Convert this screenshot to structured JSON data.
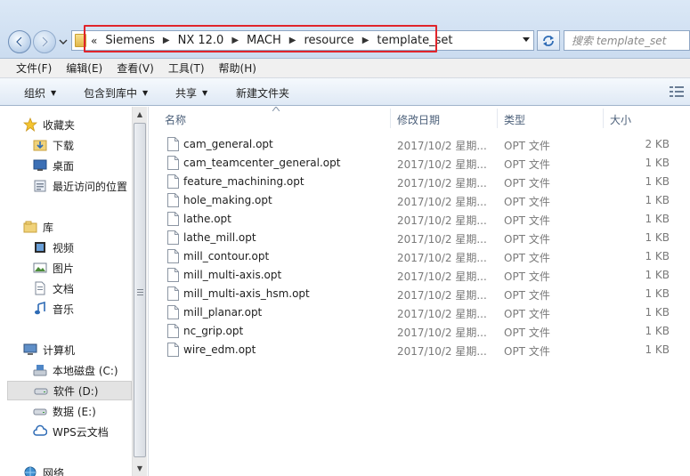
{
  "address_bar": {
    "overflow_glyph": "«",
    "crumbs": [
      "Siemens",
      "NX 12.0",
      "MACH",
      "resource",
      "template_set"
    ],
    "search_placeholder": "搜索 template_set"
  },
  "menu": [
    "文件(F)",
    "编辑(E)",
    "查看(V)",
    "工具(T)",
    "帮助(H)"
  ],
  "toolbar": {
    "organize": "组织",
    "include_in_library": "包含到库中",
    "share": "共享",
    "new_folder": "新建文件夹"
  },
  "sidebar": {
    "favorites": {
      "label": "收藏夹",
      "items": [
        "下载",
        "桌面",
        "最近访问的位置"
      ]
    },
    "libraries": {
      "label": "库",
      "items": [
        "视频",
        "图片",
        "文档",
        "音乐"
      ]
    },
    "computer": {
      "label": "计算机",
      "items": [
        "本地磁盘 (C:)",
        "软件 (D:)",
        "数据 (E:)",
        "WPS云文档"
      ]
    },
    "network": {
      "label": "网络"
    },
    "selected": "软件 (D:)"
  },
  "columns": {
    "name": "名称",
    "date": "修改日期",
    "type": "类型",
    "size": "大小"
  },
  "files": [
    {
      "name": "cam_general.opt",
      "date": "2017/10/2 星期...",
      "type": "OPT 文件",
      "size": "2 KB"
    },
    {
      "name": "cam_teamcenter_general.opt",
      "date": "2017/10/2 星期...",
      "type": "OPT 文件",
      "size": "1 KB"
    },
    {
      "name": "feature_machining.opt",
      "date": "2017/10/2 星期...",
      "type": "OPT 文件",
      "size": "1 KB"
    },
    {
      "name": "hole_making.opt",
      "date": "2017/10/2 星期...",
      "type": "OPT 文件",
      "size": "1 KB"
    },
    {
      "name": "lathe.opt",
      "date": "2017/10/2 星期...",
      "type": "OPT 文件",
      "size": "1 KB"
    },
    {
      "name": "lathe_mill.opt",
      "date": "2017/10/2 星期...",
      "type": "OPT 文件",
      "size": "1 KB"
    },
    {
      "name": "mill_contour.opt",
      "date": "2017/10/2 星期...",
      "type": "OPT 文件",
      "size": "1 KB"
    },
    {
      "name": "mill_multi-axis.opt",
      "date": "2017/10/2 星期...",
      "type": "OPT 文件",
      "size": "1 KB"
    },
    {
      "name": "mill_multi-axis_hsm.opt",
      "date": "2017/10/2 星期...",
      "type": "OPT 文件",
      "size": "1 KB"
    },
    {
      "name": "mill_planar.opt",
      "date": "2017/10/2 星期...",
      "type": "OPT 文件",
      "size": "1 KB"
    },
    {
      "name": "nc_grip.opt",
      "date": "2017/10/2 星期...",
      "type": "OPT 文件",
      "size": "1 KB"
    },
    {
      "name": "wire_edm.opt",
      "date": "2017/10/2 星期...",
      "type": "OPT 文件",
      "size": "1 KB"
    }
  ],
  "colors": {
    "highlight_box": "#e0242b",
    "toolbar_gradient_top": "#f5f9fd",
    "toolbar_gradient_bottom": "#dfe9f5",
    "header_text": "#4c607a",
    "selected_nav": "#e3e3e3"
  },
  "icons": {
    "back": "arrow-left-icon",
    "forward": "arrow-right-icon",
    "refresh": "refresh-icon",
    "search": "search-icon",
    "file": "file-icon"
  }
}
